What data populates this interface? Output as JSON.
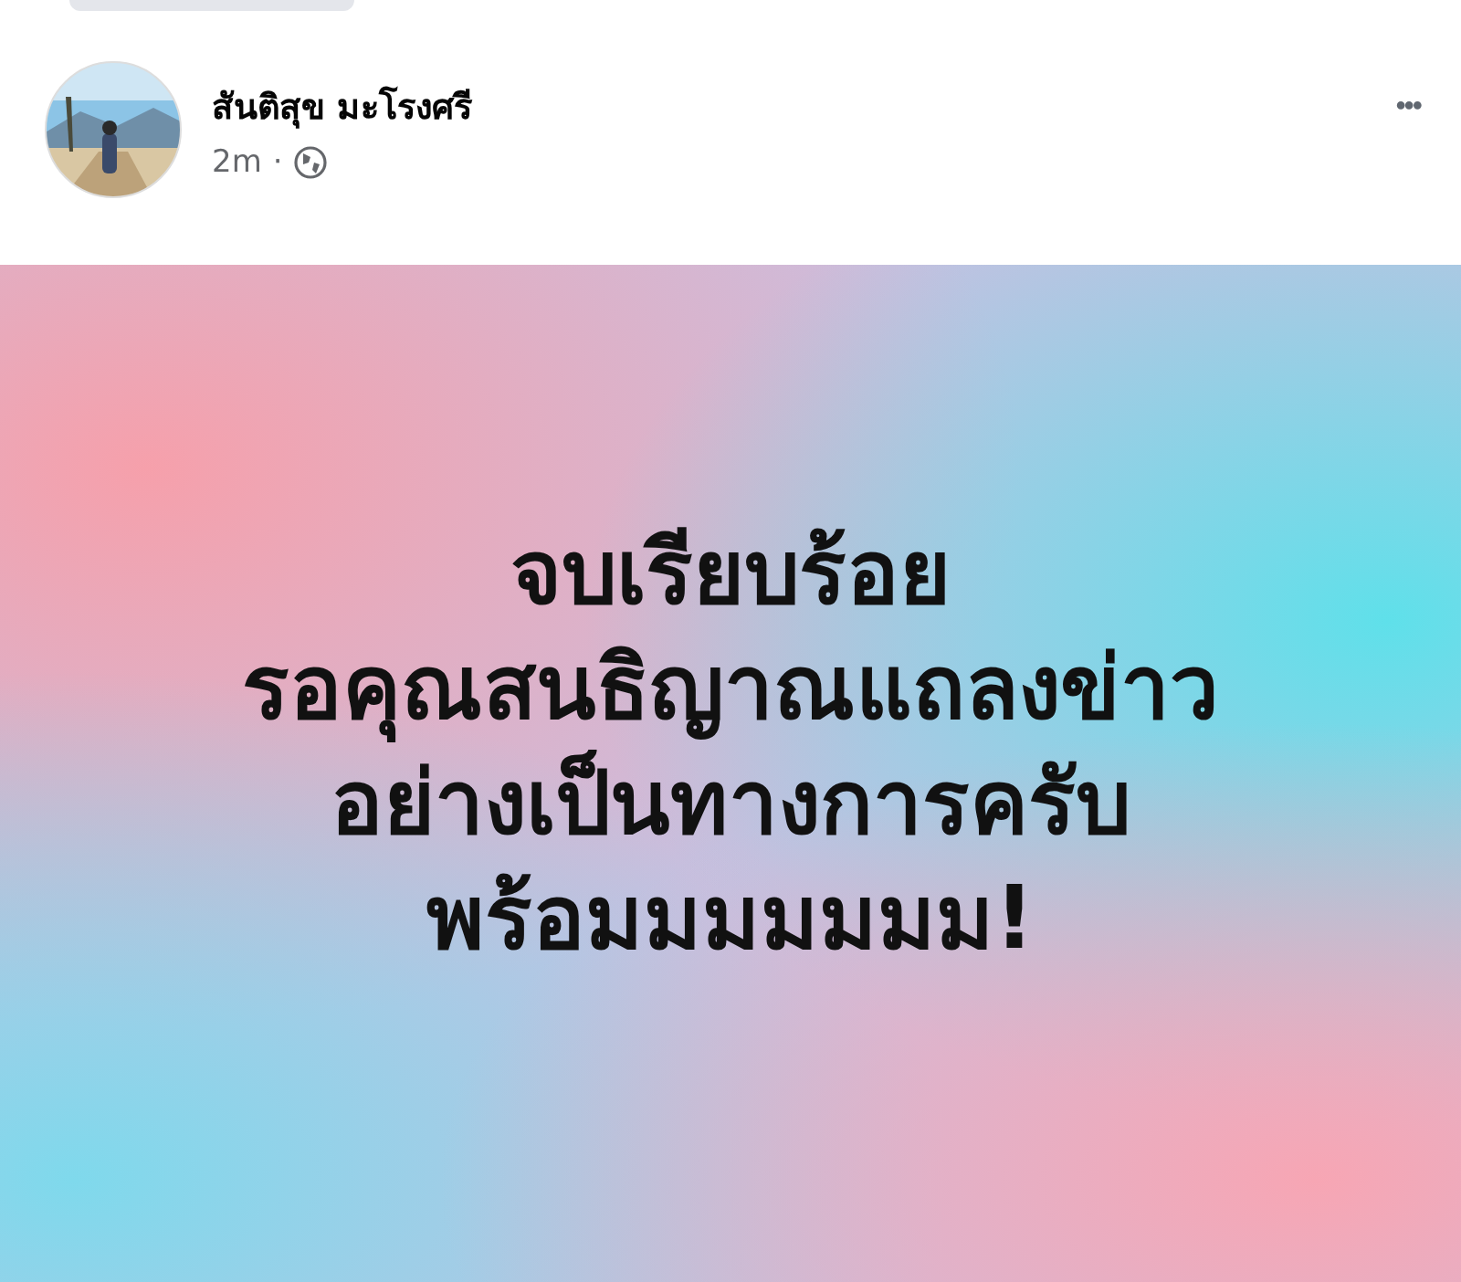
{
  "post": {
    "author": "สันติสุข มะโรงศรี",
    "time": "2m",
    "separator": "·",
    "menu": "•••",
    "message_lines": [
      "จบเรียบร้อย",
      "รอคุณสนธิญาณแถลงข่าว",
      "อย่างเป็นทางการครับ",
      "พร้อมมมมมมม!"
    ]
  }
}
